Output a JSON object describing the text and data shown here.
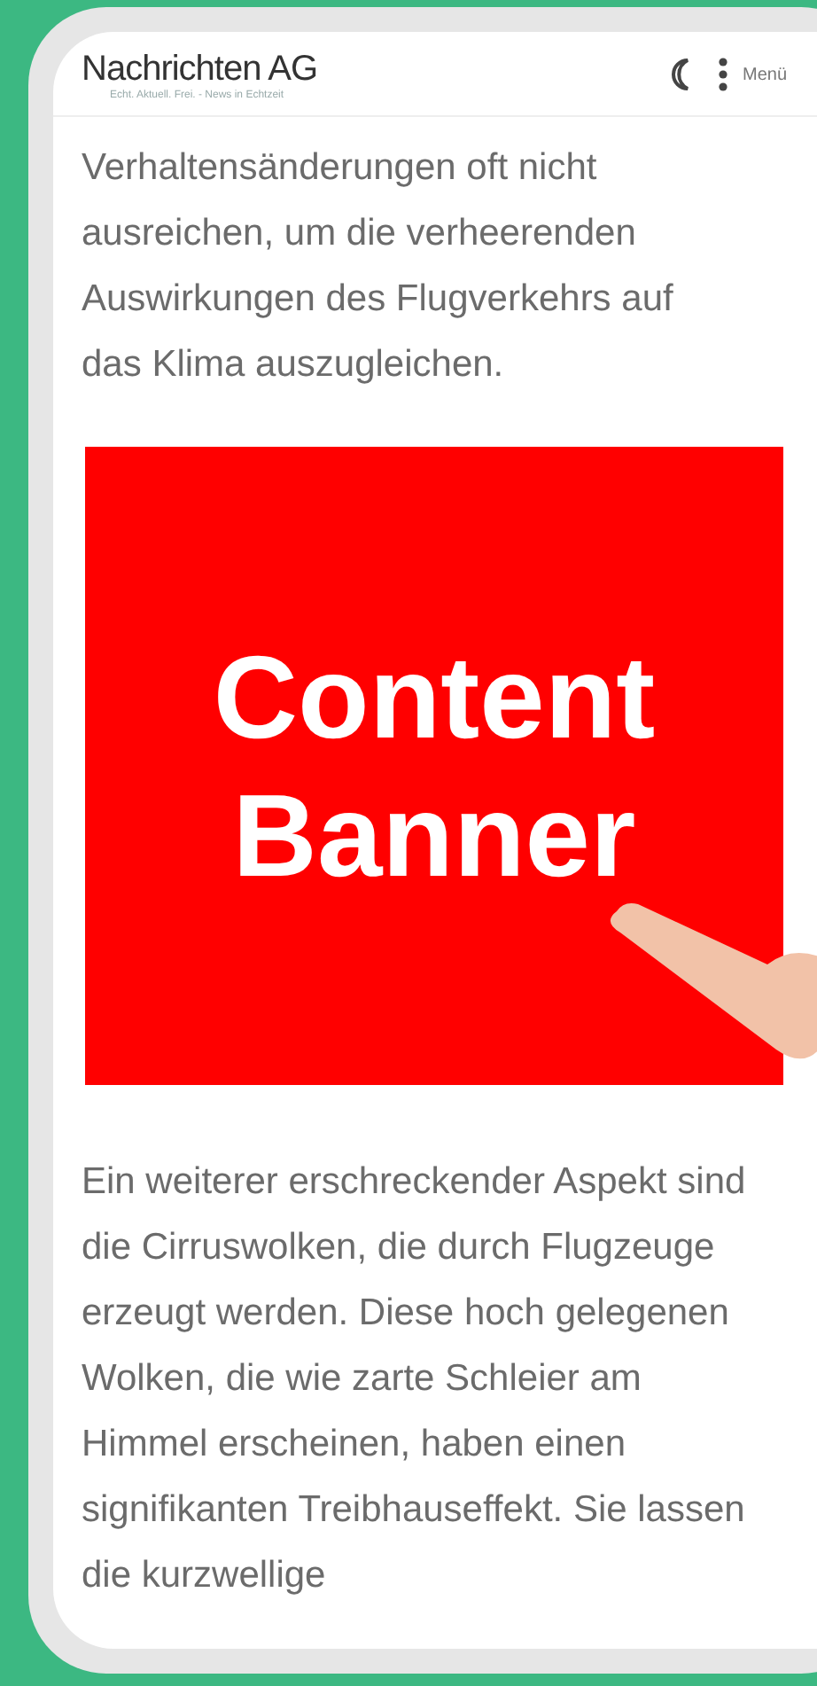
{
  "header": {
    "title": "Nachrichten AG",
    "tagline": "Echt. Aktuell. Frei. - News in Echtzeit",
    "menu_label": "Menü"
  },
  "paragraphs": [
    "Verhaltensänderungen oft nicht ausreichen, um die verheerenden Auswirkungen des Flugverkehrs auf das Klima auszugleichen.",
    "Ein weiterer erschreckender Aspekt sind die Cirruswolken, die durch Flugzeuge erzeugt werden. Diese hoch gelegenen Wolken, die wie zarte Schleier am Himmel erscheinen, haben einen signifikanten Treibhauseffekt. Sie lassen die kurzwellige"
  ],
  "banner": {
    "line_1": "Content",
    "line_2": "Banner"
  }
}
